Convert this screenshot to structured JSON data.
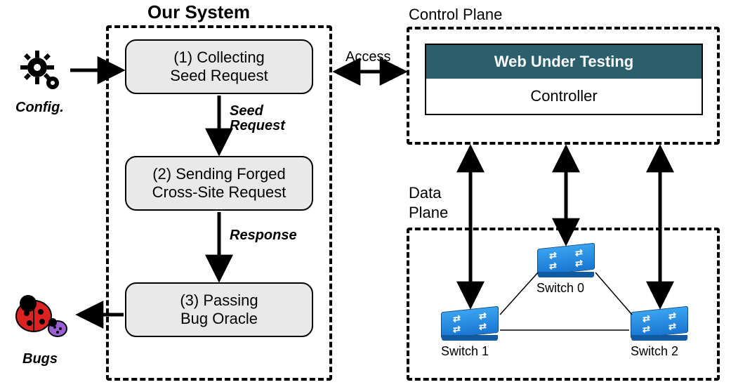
{
  "titles": {
    "our_system": "Our System",
    "control_plane": "Control Plane",
    "data_plane_line1": "Data",
    "data_plane_line2": "Plane"
  },
  "left": {
    "config_label": "Config.",
    "bugs_label": "Bugs",
    "stage1": "(1) Collecting\nSeed Request",
    "stage2": "(2) Sending Forged\nCross-Site Request",
    "stage3": "(3) Passing\nBug Oracle",
    "edge12": "Seed\nRequest",
    "edge23": "Response"
  },
  "center": {
    "access_label": "Access"
  },
  "right": {
    "wut": "Web Under Testing",
    "controller": "Controller",
    "switches": [
      {
        "name": "Switch 0"
      },
      {
        "name": "Switch 1"
      },
      {
        "name": "Switch 2"
      }
    ]
  },
  "colors": {
    "wut_bg": "#2a5f6b",
    "switch_blue": "#1976d2"
  }
}
